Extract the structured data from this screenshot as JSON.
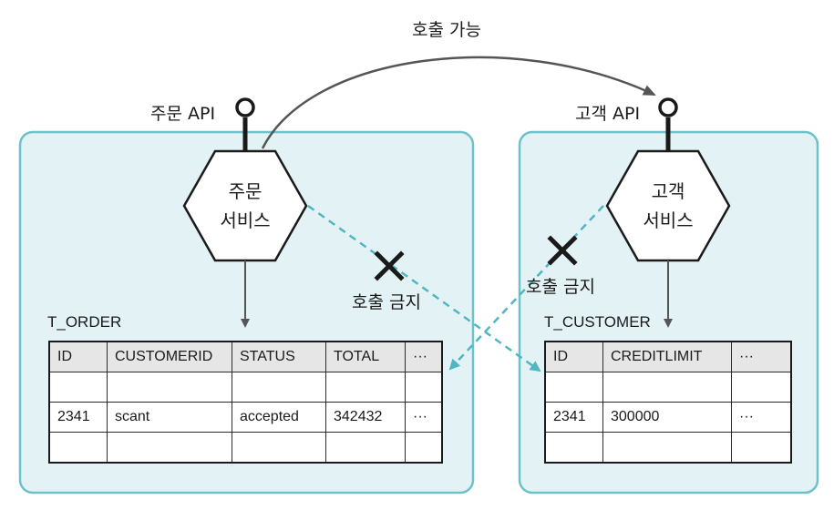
{
  "diagram": {
    "top_arrow_label": "호출 가능",
    "forbidden_label": "호출 금지",
    "order_context": {
      "api_label": "주문 API",
      "service_label_line1": "주문",
      "service_label_line2": "서비스",
      "table": {
        "name": "T_ORDER",
        "columns": [
          "ID",
          "CUSTOMERID",
          "STATUS",
          "TOTAL",
          "···"
        ],
        "rows": [
          [
            "",
            "",
            "",
            "",
            ""
          ],
          [
            "2341",
            "scant",
            "accepted",
            "342432",
            "···"
          ],
          [
            "",
            "",
            "",
            "",
            ""
          ]
        ]
      }
    },
    "customer_context": {
      "api_label": "고객 API",
      "service_label_line1": "고객",
      "service_label_line2": "서비스",
      "table": {
        "name": "T_CUSTOMER",
        "columns": [
          "ID",
          "CREDITLIMIT",
          "···"
        ],
        "rows": [
          [
            "",
            "",
            ""
          ],
          [
            "2341",
            "300000",
            "···"
          ],
          [
            "",
            "",
            ""
          ]
        ]
      }
    },
    "colors": {
      "context_fill": "#e3f3f5",
      "context_border": "#6cc1cb",
      "dashed_arrow": "#4fb6c2",
      "line": "#555555"
    }
  }
}
